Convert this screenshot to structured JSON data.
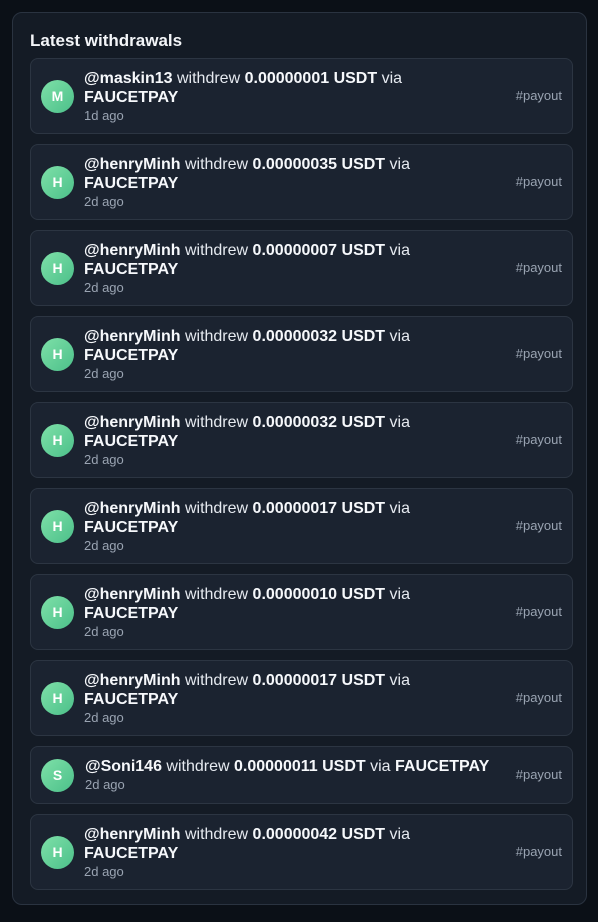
{
  "panel": {
    "title": "Latest withdrawals"
  },
  "colors": {
    "avatar": "#5ccf95",
    "card": "#1b2330",
    "panel": "#141b25"
  },
  "withdrawals": [
    {
      "initial": "M",
      "user": "@maskin13",
      "verb": "withdrew",
      "amount": "0.00000001 USDT",
      "via": "via",
      "method": "FAUCETPAY",
      "time": "1d ago",
      "tag": "#payout"
    },
    {
      "initial": "H",
      "user": "@henryMinh",
      "verb": "withdrew",
      "amount": "0.00000035 USDT",
      "via": "via",
      "method": "FAUCETPAY",
      "time": "2d ago",
      "tag": "#payout"
    },
    {
      "initial": "H",
      "user": "@henryMinh",
      "verb": "withdrew",
      "amount": "0.00000007 USDT",
      "via": "via",
      "method": "FAUCETPAY",
      "time": "2d ago",
      "tag": "#payout"
    },
    {
      "initial": "H",
      "user": "@henryMinh",
      "verb": "withdrew",
      "amount": "0.00000032 USDT",
      "via": "via",
      "method": "FAUCETPAY",
      "time": "2d ago",
      "tag": "#payout"
    },
    {
      "initial": "H",
      "user": "@henryMinh",
      "verb": "withdrew",
      "amount": "0.00000032 USDT",
      "via": "via",
      "method": "FAUCETPAY",
      "time": "2d ago",
      "tag": "#payout"
    },
    {
      "initial": "H",
      "user": "@henryMinh",
      "verb": "withdrew",
      "amount": "0.00000017 USDT",
      "via": "via",
      "method": "FAUCETPAY",
      "time": "2d ago",
      "tag": "#payout"
    },
    {
      "initial": "H",
      "user": "@henryMinh",
      "verb": "withdrew",
      "amount": "0.00000010 USDT",
      "via": "via",
      "method": "FAUCETPAY",
      "time": "2d ago",
      "tag": "#payout"
    },
    {
      "initial": "H",
      "user": "@henryMinh",
      "verb": "withdrew",
      "amount": "0.00000017 USDT",
      "via": "via",
      "method": "FAUCETPAY",
      "time": "2d ago",
      "tag": "#payout"
    },
    {
      "initial": "S",
      "user": "@Soni146",
      "verb": "withdrew",
      "amount": "0.00000011 USDT",
      "via": "via",
      "method": "FAUCETPAY",
      "time": "2d ago",
      "tag": "#payout"
    },
    {
      "initial": "H",
      "user": "@henryMinh",
      "verb": "withdrew",
      "amount": "0.00000042 USDT",
      "via": "via",
      "method": "FAUCETPAY",
      "time": "2d ago",
      "tag": "#payout"
    }
  ]
}
